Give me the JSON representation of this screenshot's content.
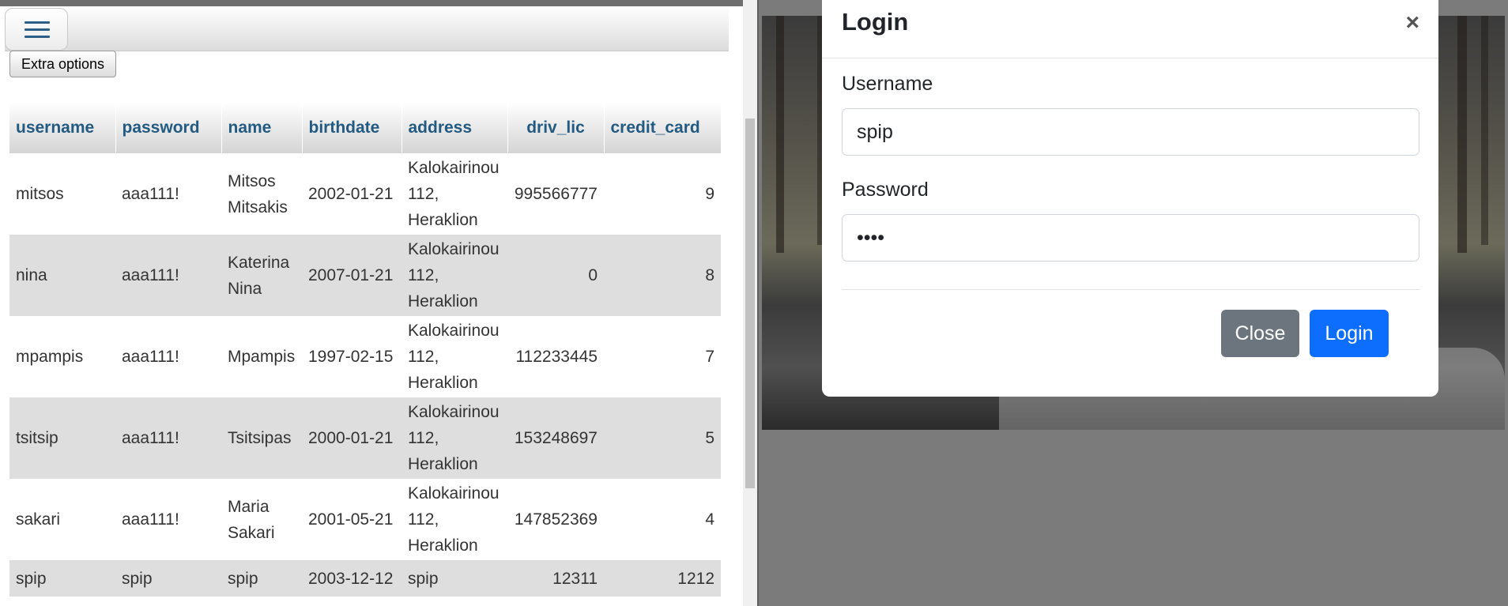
{
  "toolbar": {
    "menu_icon": "hamburger-menu-icon",
    "extra_options_label": "Extra options"
  },
  "table": {
    "columns": [
      "username",
      "password",
      "name",
      "birthdate",
      "address",
      "driv_lic",
      "credit_card"
    ],
    "rows": [
      {
        "username": "mitsos",
        "password": "aaa111!",
        "name_line1": "Mitsos",
        "name_line2": "Mitsakis",
        "birthdate": "2002-01-21",
        "addr_line1": "Kalokairinou",
        "addr_line2": "112,",
        "addr_line3": "Heraklion",
        "driv_lic": "995566777",
        "credit_card": "9"
      },
      {
        "username": "nina",
        "password": "aaa111!",
        "name_line1": "Katerina",
        "name_line2": "Nina",
        "birthdate": "2007-01-21",
        "addr_line1": "Kalokairinou",
        "addr_line2": "112,",
        "addr_line3": "Heraklion",
        "driv_lic": "0",
        "credit_card": "8"
      },
      {
        "username": "mpampis",
        "password": "aaa111!",
        "name_line1": "Mpampis",
        "name_line2": "",
        "birthdate": "1997-02-15",
        "addr_line1": "Kalokairinou",
        "addr_line2": "112,",
        "addr_line3": "Heraklion",
        "driv_lic": "112233445",
        "credit_card": "7"
      },
      {
        "username": "tsitsip",
        "password": "aaa111!",
        "name_line1": "Tsitsipas",
        "name_line2": "",
        "birthdate": "2000-01-21",
        "addr_line1": "Kalokairinou",
        "addr_line2": "112,",
        "addr_line3": "Heraklion",
        "driv_lic": "153248697",
        "credit_card": "5"
      },
      {
        "username": "sakari",
        "password": "aaa111!",
        "name_line1": "Maria",
        "name_line2": "Sakari",
        "birthdate": "2001-05-21",
        "addr_line1": "Kalokairinou",
        "addr_line2": "112,",
        "addr_line3": "Heraklion",
        "driv_lic": "147852369",
        "credit_card": "4"
      },
      {
        "username": "spip",
        "password": "spip",
        "name_line1": "spip",
        "name_line2": "",
        "birthdate": "2003-12-12",
        "addr_line1": "spip",
        "addr_line2": "",
        "addr_line3": "",
        "driv_lic": "12311",
        "credit_card": "1212"
      }
    ]
  },
  "modal": {
    "title": "Login",
    "close_glyph": "×",
    "username_label": "Username",
    "username_value": "spip",
    "password_label": "Password",
    "password_value": "••••",
    "close_button": "Close",
    "login_button": "Login"
  },
  "colors": {
    "header_text": "#235a81",
    "primary": "#0d6efd",
    "secondary": "#6c757d",
    "overlay": "#7b7b7b"
  }
}
